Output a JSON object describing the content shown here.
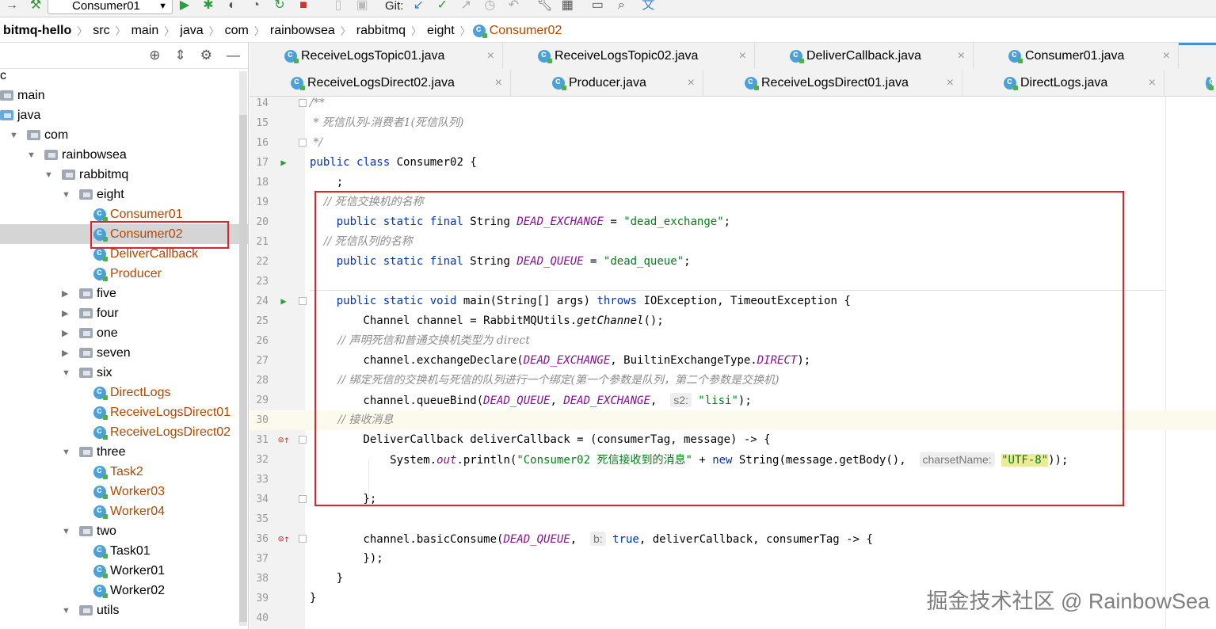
{
  "toolbar": {
    "run_config": "Consumer01",
    "git_label": "Git:"
  },
  "breadcrumb": [
    "bitmq-hello",
    "src",
    "main",
    "java",
    "com",
    "rainbowsea",
    "rabbitmq",
    "eight",
    "Consumer02"
  ],
  "project_tree": [
    {
      "label": "c",
      "indent": 0,
      "kind": "text"
    },
    {
      "label": "main",
      "indent": 0,
      "kind": "folder"
    },
    {
      "label": "java",
      "indent": 0,
      "kind": "folder-blue"
    },
    {
      "label": "com",
      "indent": 1,
      "kind": "folder",
      "arrow": "open"
    },
    {
      "label": "rainbowsea",
      "indent": 2,
      "kind": "folder",
      "arrow": "open"
    },
    {
      "label": "rabbitmq",
      "indent": 3,
      "kind": "folder",
      "arrow": "open"
    },
    {
      "label": "eight",
      "indent": 4,
      "kind": "folder",
      "arrow": "open"
    },
    {
      "label": "Consumer01",
      "indent": 5,
      "kind": "class"
    },
    {
      "label": "Consumer02",
      "indent": 5,
      "kind": "class",
      "selected": true
    },
    {
      "label": "DeliverCallback",
      "indent": 5,
      "kind": "class"
    },
    {
      "label": "Producer",
      "indent": 5,
      "kind": "class"
    },
    {
      "label": "five",
      "indent": 4,
      "kind": "folder",
      "arrow": "closed"
    },
    {
      "label": "four",
      "indent": 4,
      "kind": "folder",
      "arrow": "closed"
    },
    {
      "label": "one",
      "indent": 4,
      "kind": "folder",
      "arrow": "closed"
    },
    {
      "label": "seven",
      "indent": 4,
      "kind": "folder",
      "arrow": "closed"
    },
    {
      "label": "six",
      "indent": 4,
      "kind": "folder",
      "arrow": "open"
    },
    {
      "label": "DirectLogs",
      "indent": 5,
      "kind": "class"
    },
    {
      "label": "ReceiveLogsDirect01",
      "indent": 5,
      "kind": "class"
    },
    {
      "label": "ReceiveLogsDirect02",
      "indent": 5,
      "kind": "class"
    },
    {
      "label": "three",
      "indent": 4,
      "kind": "folder",
      "arrow": "open"
    },
    {
      "label": "Task2",
      "indent": 5,
      "kind": "class"
    },
    {
      "label": "Worker03",
      "indent": 5,
      "kind": "class"
    },
    {
      "label": "Worker04",
      "indent": 5,
      "kind": "class"
    },
    {
      "label": "two",
      "indent": 4,
      "kind": "folder",
      "arrow": "open"
    },
    {
      "label": "Task01",
      "indent": 5,
      "kind": "class-black"
    },
    {
      "label": "Worker01",
      "indent": 5,
      "kind": "class-black"
    },
    {
      "label": "Worker02",
      "indent": 5,
      "kind": "class-black"
    },
    {
      "label": "utils",
      "indent": 4,
      "kind": "folder",
      "arrow": "open"
    }
  ],
  "tabs_row1": [
    "ReceiveLogsTopic01.java",
    "ReceiveLogsTopic02.java",
    "DeliverCallback.java",
    "Consumer01.java"
  ],
  "tabs_row2": [
    "ReceiveLogsDirect02.java",
    "Producer.java",
    "ReceiveLogsDirect01.java",
    "DirectLogs.java"
  ],
  "line_numbers": [
    "14",
    "15",
    "16",
    "17",
    "18",
    "19",
    "20",
    "21",
    "22",
    "23",
    "24",
    "25",
    "26",
    "27",
    "28",
    "29",
    "30",
    "31",
    "32",
    "33",
    "34",
    "35",
    "36",
    "37",
    "38",
    "39",
    "40"
  ],
  "code": {
    "l14": "/**",
    "l15": " * 死信队列-消费者1(死信队列)",
    "l16": " */",
    "l17_kw1": "public",
    "l17_kw2": "class",
    "l17_rest": " Consumer02 {",
    "l18": "    ;",
    "l19": "    // 死信交换机的名称",
    "l20_kw": "    public static final",
    "l20_type": " String ",
    "l20_const": "DEAD_EXCHANGE",
    "l20_eq": " = ",
    "l20_str": "\"dead_exchange\"",
    "l20_end": ";",
    "l21": "    // 死信队列的名称",
    "l22_kw": "    public static final",
    "l22_type": " String ",
    "l22_const": "DEAD_QUEUE",
    "l22_eq": " = ",
    "l22_str": "\"dead_queue\"",
    "l22_end": ";",
    "l24_kw": "    public static void",
    "l24_mid": " main(String[] args) ",
    "l24_throws": "throws",
    "l24_rest": " IOException, TimeoutException {",
    "l25_a": "        Channel channel = RabbitMQUtils.",
    "l25_b": "getChannel",
    "l25_c": "();",
    "l26": "        // 声明死信和普通交换机类型为 direct",
    "l27_a": "        channel.exchangeDeclare(",
    "l27_b": "DEAD_EXCHANGE",
    "l27_c": ", BuiltinExchangeType.",
    "l27_d": "DIRECT",
    "l27_e": ");",
    "l28": "        // 绑定死信的交换机与死信的队列进行一个绑定(第一个参数是队列，第二个参数是交换机)",
    "l29_a": "        channel.queueBind(",
    "l29_b": "DEAD_QUEUE",
    "l29_c": ", ",
    "l29_d": "DEAD_EXCHANGE",
    "l29_e": ",  ",
    "l29_hint": "s2:",
    "l29_str": " \"lisi\"",
    "l29_end": ");",
    "l30": "        // 接收消息",
    "l31": "        DeliverCallback deliverCallback = (consumerTag, message) -> {",
    "l32_a": "            System.",
    "l32_b": "out",
    "l32_c": ".println(",
    "l32_str": "\"Consumer02 死信接收到的消息\"",
    "l32_d": " + ",
    "l32_new": "new",
    "l32_e": " String(message.getBody(),  ",
    "l32_hint": "charsetName:",
    "l32_str2": "\"UTF-8\"",
    "l32_end": "));",
    "l34": "        };",
    "l36_a": "        channel.basicConsume(",
    "l36_b": "DEAD_QUEUE",
    "l36_c": ",  ",
    "l36_hint": "b:",
    "l36_true": " true",
    "l36_d": ", deliverCallback, consumerTag -> {",
    "l37": "        });",
    "l38": "    }",
    "l39": "}"
  },
  "watermark": "掘金技术社区 @ RainbowSea"
}
